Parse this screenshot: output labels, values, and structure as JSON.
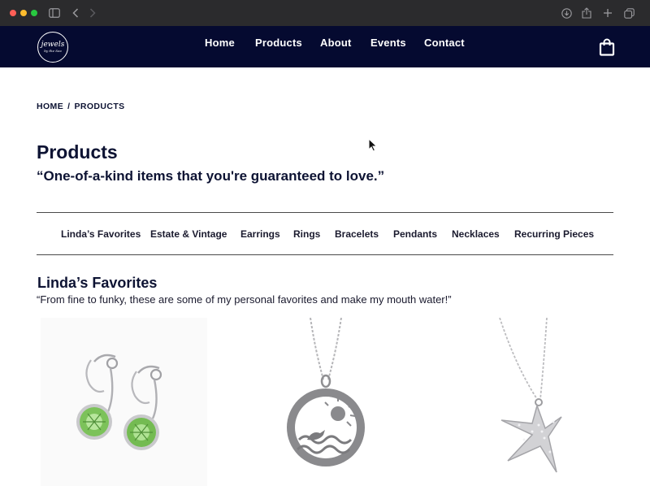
{
  "nav": {
    "logo_line1": "jewels",
    "logo_line2": "by the Sea",
    "links": [
      "Home",
      "Products",
      "About",
      "Events",
      "Contact"
    ]
  },
  "breadcrumb": {
    "home": "HOME",
    "separator": "/",
    "current": "PRODUCTS"
  },
  "page": {
    "title": "Products",
    "tagline": "“One-of-a-kind items that you're guaranteed to love.”"
  },
  "categories": [
    "Linda’s Favorites",
    "Estate & Vintage",
    "Earrings",
    "Rings",
    "Bracelets",
    "Pendants",
    "Necklaces",
    "Recurring Pieces"
  ],
  "section": {
    "title": "Linda’s Favorites",
    "description": "“From fine to funky, these are some of my personal favorites and make my mouth water!”"
  },
  "colors": {
    "nav_bg": "#050a30",
    "heading": "#0d1333"
  }
}
